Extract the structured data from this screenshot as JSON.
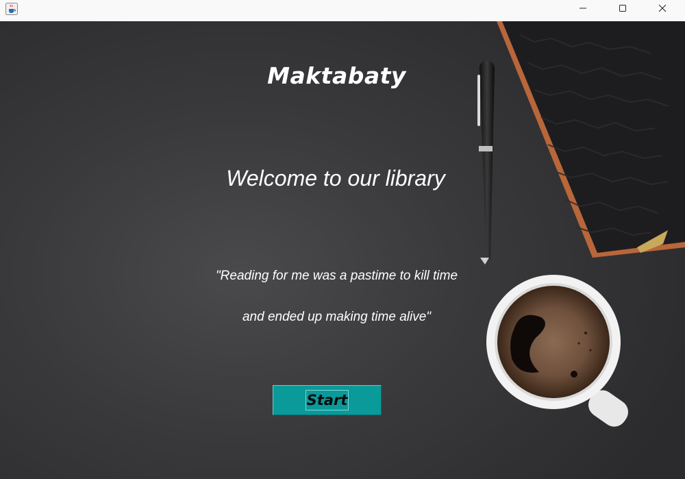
{
  "window": {
    "app_icon": "java-cup-icon",
    "controls": {
      "minimize": "minimize-icon",
      "maximize": "maximize-icon",
      "close": "close-icon"
    }
  },
  "main": {
    "title": "Maktabaty",
    "welcome": "Welcome to our library",
    "quote_line_1": "\"Reading for me was a pastime to kill time",
    "quote_line_2": "and ended up making time alive\"",
    "start_button_label": "Start"
  },
  "colors": {
    "background": "#3a3a3d",
    "button": "#0a9a9a",
    "text": "#ffffff"
  }
}
